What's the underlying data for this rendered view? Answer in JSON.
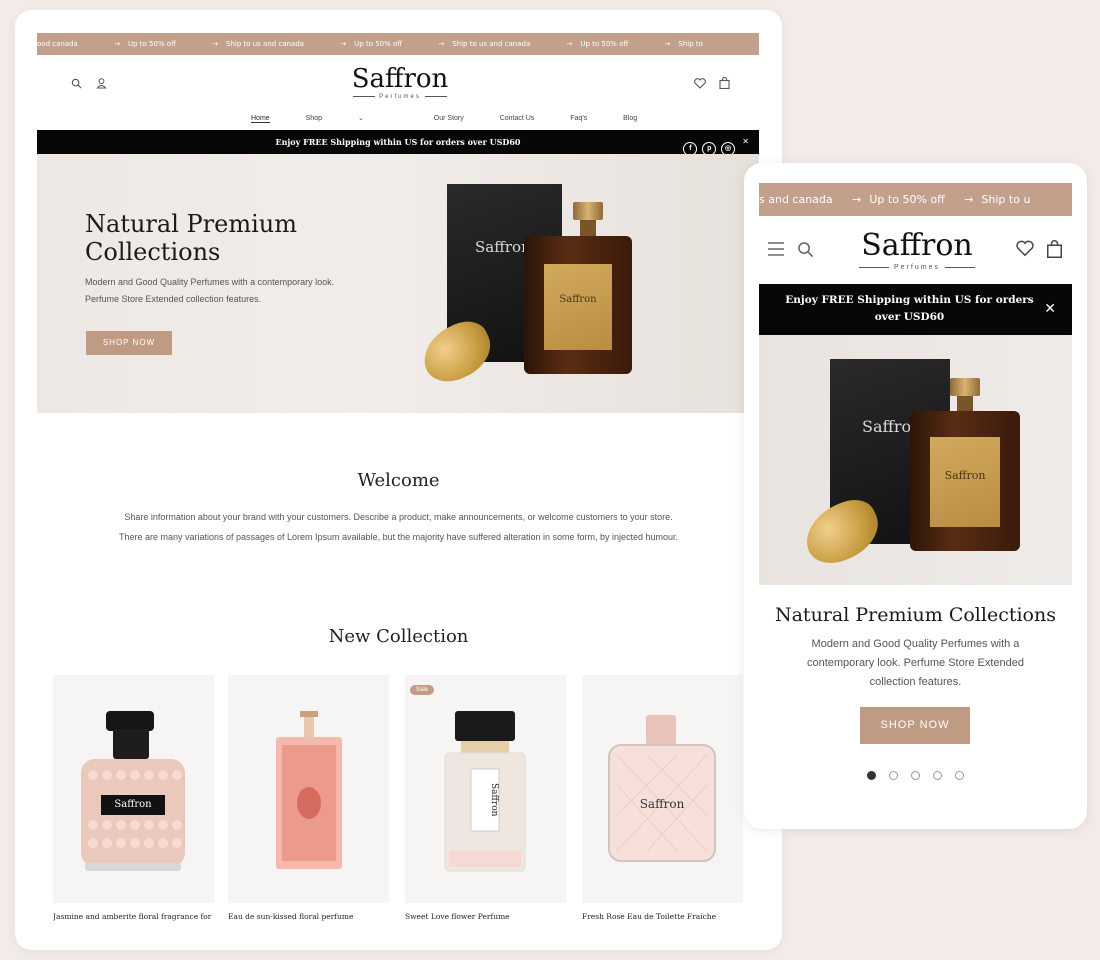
{
  "ticker": {
    "items": [
      "ood canada",
      "Up to 50% off",
      "Ship to us and canada",
      "Up to 50% off",
      "Ship to us and canada",
      "Up to 50% off",
      "Ship to"
    ],
    "mobile_items": [
      "s and canada",
      "Up to 50% off",
      "Ship to u"
    ]
  },
  "header": {
    "brand": "Saffron",
    "brand_sub": "Perfumes",
    "icons": [
      "search-icon",
      "user-icon",
      "heart-icon",
      "cart-icon"
    ]
  },
  "nav": {
    "items": [
      "Home",
      "Shop",
      "Our Story",
      "Contact Us",
      "Faq's",
      "Blog"
    ],
    "shop_caret": "⌄"
  },
  "announcement": {
    "text": "Enjoy FREE Shipping within US for orders over USD60",
    "social": [
      "f",
      "p",
      "◎"
    ],
    "close": "✕"
  },
  "hero": {
    "title_line1": "Natural Premium",
    "title_line2": "Collections",
    "title_full": "Natural Premium Collections",
    "desc_line1": "Modern and Good Quality Perfumes with a contemporary look.",
    "desc_line2": "Perfume Store Extended collection features.",
    "desc_mobile": "Modern and Good Quality Perfumes with a contemporary look. Perfume Store Extended collection features.",
    "cta": "SHOP NOW",
    "box_label": "Saffron",
    "bottle_label": "Saffron"
  },
  "welcome": {
    "title": "Welcome",
    "text": "Share information about your brand with your customers. Describe a product, make announcements, or welcome customers to your store. There are many variations of passages of Lorem Ipsum available, but the majority have suffered alteration in some form, by injected humour."
  },
  "collection": {
    "title": "New Collection",
    "sale_badge": "Sale",
    "products": [
      {
        "name": "Jasmine and amberite floral fragrance for",
        "label": "Saffron"
      },
      {
        "name": "Eau de sun-kissed floral perfume",
        "label": ""
      },
      {
        "name": "Sweet Love flower Perfume",
        "label": "Saffron"
      },
      {
        "name": "Fresh Rose Eau de Toilette Fraiche",
        "label": "Saffron"
      }
    ]
  },
  "mobile": {
    "slides": 5,
    "active_slide": 1
  },
  "colors": {
    "accent": "#c09b84",
    "ticker": "#c3a08c",
    "announcement_bg": "#070707"
  }
}
